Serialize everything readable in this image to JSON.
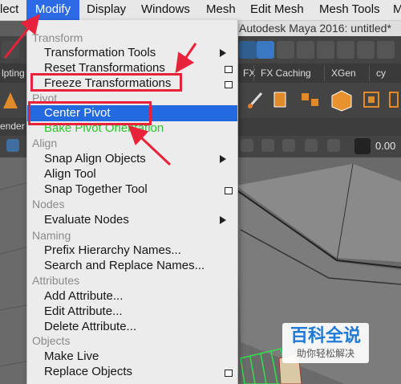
{
  "menubar": {
    "items": [
      "lect",
      "Modify",
      "Display",
      "Windows",
      "Mesh",
      "Edit Mesh",
      "Mesh Tools",
      "M"
    ]
  },
  "window": {
    "title": "Autodesk Maya 2016: untitled*"
  },
  "shelf_tabs": [
    "lpting",
    "FX",
    "FX Caching",
    "XGen",
    "cy"
  ],
  "panel": {
    "left_label": "ender",
    "value": "0.00"
  },
  "menu": {
    "sections": {
      "transform": "Transform",
      "pivot": "Pivot",
      "align": "Align",
      "nodes": "Nodes",
      "naming": "Naming",
      "attributes": "Attributes",
      "objects": "Objects"
    },
    "items": {
      "transformation_tools": "Transformation Tools",
      "reset_transformations": "Reset Transformations",
      "freeze_transformations": "Freeze Transformations",
      "center_pivot": "Center Pivot",
      "bake_pivot_orientation": "Bake Pivot Orientation",
      "snap_align_objects": "Snap Align Objects",
      "align_tool": "Align Tool",
      "snap_together_tool": "Snap Together Tool",
      "evaluate_nodes": "Evaluate Nodes",
      "prefix_hierarchy_names": "Prefix Hierarchy Names...",
      "search_replace_names": "Search and Replace Names...",
      "add_attribute": "Add Attribute...",
      "edit_attribute": "Edit Attribute...",
      "delete_attribute": "Delete Attribute...",
      "make_live": "Make Live",
      "replace_objects": "Replace Objects"
    },
    "highlighted_item": "Center Pivot"
  },
  "watermark": {
    "title": "百科全说",
    "subtitle": "助你轻松解决"
  },
  "colors": {
    "menu_highlight": "#2369e0",
    "menubar_active": "#2d6be6",
    "annotation_red": "#e8223a",
    "bake_pivot_green": "#28c628",
    "watermark_blue": "#1f7ad6"
  }
}
